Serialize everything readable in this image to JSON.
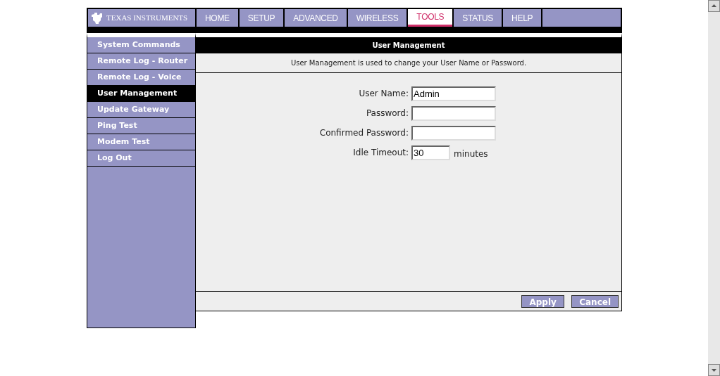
{
  "brand": {
    "name": "TEXAS INSTRUMENTS"
  },
  "nav_tabs": [
    {
      "label": "HOME",
      "selected": false
    },
    {
      "label": "SETUP",
      "selected": false
    },
    {
      "label": "ADVANCED",
      "selected": false
    },
    {
      "label": "WIRELESS",
      "selected": false
    },
    {
      "label": "TOOLS",
      "selected": true
    },
    {
      "label": "STATUS",
      "selected": false
    },
    {
      "label": "HELP",
      "selected": false
    }
  ],
  "sidebar": {
    "items": [
      {
        "label": "System Commands",
        "selected": false
      },
      {
        "label": "Remote Log - Router",
        "selected": false
      },
      {
        "label": "Remote Log - Voice",
        "selected": false
      },
      {
        "label": "User Management",
        "selected": true
      },
      {
        "label": "Update Gateway",
        "selected": false
      },
      {
        "label": "Ping Test",
        "selected": false
      },
      {
        "label": "Modem Test",
        "selected": false
      },
      {
        "label": "Log Out",
        "selected": false
      }
    ]
  },
  "panel": {
    "title": "User Management",
    "description": "User Management is used to change your User Name or Password.",
    "fields": [
      {
        "label": "User Name:",
        "value": "Admin",
        "kind": "text"
      },
      {
        "label": "Password:",
        "kind": "password"
      },
      {
        "label": "Confirmed Password:",
        "kind": "password"
      },
      {
        "label": "Idle Timeout:",
        "value": "30",
        "kind": "short",
        "unit": "minutes"
      }
    ],
    "buttons": [
      "Apply",
      "Cancel"
    ]
  }
}
